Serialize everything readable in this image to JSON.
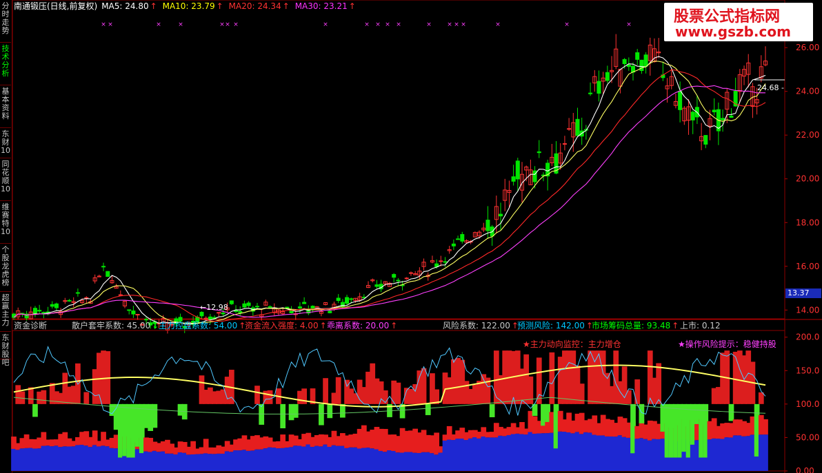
{
  "sidebar": {
    "tabs": [
      {
        "label": "分时走势",
        "active": false
      },
      {
        "label": "技术分析",
        "active": true
      },
      {
        "label": "基本资料",
        "active": false
      },
      {
        "label": "东财10",
        "active": false
      },
      {
        "label": "同花顺10",
        "active": false
      },
      {
        "label": "维赛特10",
        "active": false
      },
      {
        "label": "个股龙虎榜",
        "active": false
      },
      {
        "label": "超赢主力",
        "active": false
      },
      {
        "label": "东财股吧",
        "active": false
      }
    ]
  },
  "main_chart": {
    "stock_title": "南通锻压(日线,前复权)",
    "ma_legend": [
      {
        "label": "MA5: 24.80",
        "color": "#ffffff"
      },
      {
        "label": "MA10: 23.79",
        "color": "#ffff00"
      },
      {
        "label": "MA20: 24.34",
        "color": "#ff3232"
      },
      {
        "label": "MA30: 23.21",
        "color": "#ff32ff"
      }
    ],
    "price_axis": [
      "26.00",
      "24.00",
      "22.00",
      "20.00",
      "18.00",
      "16.00",
      "14.00"
    ],
    "price_range": [
      13.6,
      27.8
    ],
    "current_price_tag": "13.37",
    "low_label": "12.98",
    "last_label": "24.68",
    "colors": {
      "up": "#ff3232",
      "down": "#00e600",
      "ma5": "#ffffff",
      "ma10": "#ffff64",
      "ma20": "#ff2828",
      "ma30": "#ff40ff",
      "grid": "#8b0000"
    }
  },
  "indicator": {
    "title": "资金诊断",
    "params": [
      {
        "label": "散户套牢系数: 45.00",
        "arrow": "↓",
        "color": "#c8c8c8",
        "arrow_color": "#00ff00"
      },
      {
        "label": "主力控盘系数: 54.00",
        "arrow": "↑",
        "color": "#00c8ff",
        "arrow_color": "#ff3232"
      },
      {
        "label": "资金流入强度: 4.00",
        "arrow": "↑",
        "color": "#ff3232",
        "arrow_color": "#ff3232"
      },
      {
        "label": "乖离系数: 20.00",
        "arrow": "↑",
        "color": "#ff40ff",
        "arrow_color": "#ff3232"
      },
      {
        "label": "风险系数: 122.00",
        "arrow": "↑",
        "color": "#c8c8c8",
        "arrow_color": "#ff3232"
      },
      {
        "label": "预测风险: 142.00",
        "arrow": "↑",
        "color": "#00c8ff",
        "arrow_color": "#ff3232"
      },
      {
        "label": "市场筹码总量: 93.48",
        "arrow": "↑",
        "color": "#00ff00",
        "arrow_color": "#ff3232"
      },
      {
        "label": "上市: 0.12",
        "arrow": "",
        "color": "#c8c8c8",
        "arrow_color": "#c8c8c8"
      }
    ],
    "axis": [
      "200.0",
      "150.0",
      "100.0",
      "50.00",
      "0.00"
    ],
    "notice_main": "★主力动向监控：主力增仓",
    "notice_risk": "★操作风险提示：稳健持股"
  },
  "logo": {
    "line1": "股票公式指标网",
    "line2": "www.gszb.com"
  }
}
